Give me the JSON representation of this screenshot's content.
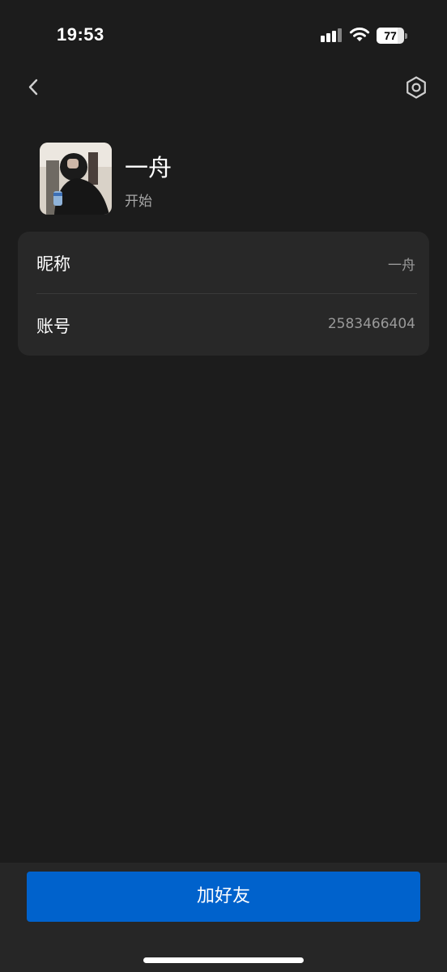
{
  "status_bar": {
    "time": "19:53",
    "battery_level": "77",
    "battery_fraction": 0.77,
    "icons": [
      "signal-icon",
      "wifi-icon",
      "battery-icon"
    ]
  },
  "nav": {
    "back_icon": "chevron-left-icon",
    "settings_icon": "hexagon-settings-icon"
  },
  "profile": {
    "name": "一舟",
    "status": "开始"
  },
  "info": {
    "rows": [
      {
        "label": "昵称",
        "value": "一舟"
      },
      {
        "label": "账号",
        "value": "2583466404"
      }
    ]
  },
  "actions": {
    "add_friend_label": "加好友"
  },
  "colors": {
    "background": "#1c1c1c",
    "card": "#282828",
    "bottom_bar": "#262626",
    "primary_button": "#0062cc",
    "secondary_text": "#a7a7a7"
  }
}
